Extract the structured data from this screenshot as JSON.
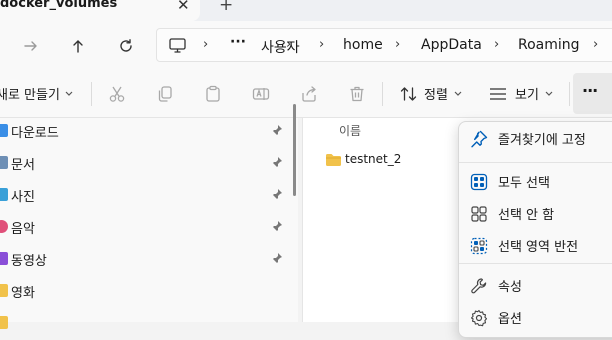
{
  "tab": {
    "title": "docker_volumes",
    "close": "✕",
    "new": "+"
  },
  "nav": {
    "path": [
      "사용자",
      "home",
      "AppData",
      "Roaming"
    ],
    "overflow": "···"
  },
  "toolbar": {
    "new_label": "새로 만들기",
    "sort_label": "정렬",
    "view_label": "보기",
    "more": "···"
  },
  "sidebar": {
    "items": [
      {
        "label": "다운로드",
        "pinned": true,
        "color": "#3a8ee6"
      },
      {
        "label": "문서",
        "pinned": true,
        "color": "#6e8fb5"
      },
      {
        "label": "사진",
        "pinned": true,
        "color": "#3aa0d8"
      },
      {
        "label": "음악",
        "pinned": true,
        "color": "#e0507a"
      },
      {
        "label": "동영상",
        "pinned": true,
        "color": "#8a4fd8"
      },
      {
        "label": "영화",
        "pinned": false,
        "color": "#f1c24b"
      }
    ]
  },
  "content": {
    "column_header": "이름",
    "files": [
      {
        "name": "testnet_2",
        "type": "folder"
      }
    ]
  },
  "menu": {
    "items": [
      {
        "label": "즐겨찾기에 고정",
        "icon": "pin-icon"
      },
      {
        "label": "모두 선택",
        "icon": "select-all-icon"
      },
      {
        "label": "선택 안 함",
        "icon": "select-none-icon"
      },
      {
        "label": "선택 영역 반전",
        "icon": "invert-selection-icon"
      },
      {
        "label": "속성",
        "icon": "wrench-icon"
      },
      {
        "label": "옵션",
        "icon": "gear-icon"
      }
    ]
  },
  "colors": {
    "accent": "#005fb8",
    "folder": "#f1c24b"
  }
}
